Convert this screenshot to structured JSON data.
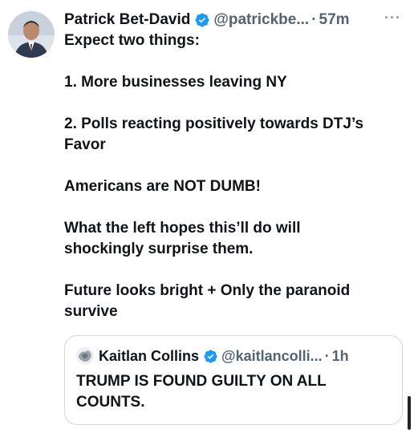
{
  "tweet": {
    "author_name": "Patrick Bet-David",
    "handle": "@patrickbe...",
    "separator": "·",
    "time": "57m",
    "more_icon": "···",
    "lines": [
      "Expect two things:",
      "",
      "1.  More businesses leaving NY",
      "",
      "2.  Polls reacting positively towards DTJ’s",
      "Favor",
      "",
      "Americans are NOT DUMB!",
      "",
      "What the left hopes this’ll do will",
      "shockingly surprise them.",
      "",
      "Future looks bright + Only the paranoid",
      "survive"
    ]
  },
  "quoted_tweet": {
    "author_name": "Kaitlan Collins",
    "handle": "@kaitlancolli...",
    "separator": "·",
    "time": "1h",
    "lines": [
      "TRUMP IS FOUND GUILTY ON ALL",
      "COUNTS."
    ]
  },
  "colors": {
    "verified_blue": "#1d9bf0",
    "text": "#0f1419",
    "secondary": "#536471",
    "border": "#cfd9de"
  }
}
